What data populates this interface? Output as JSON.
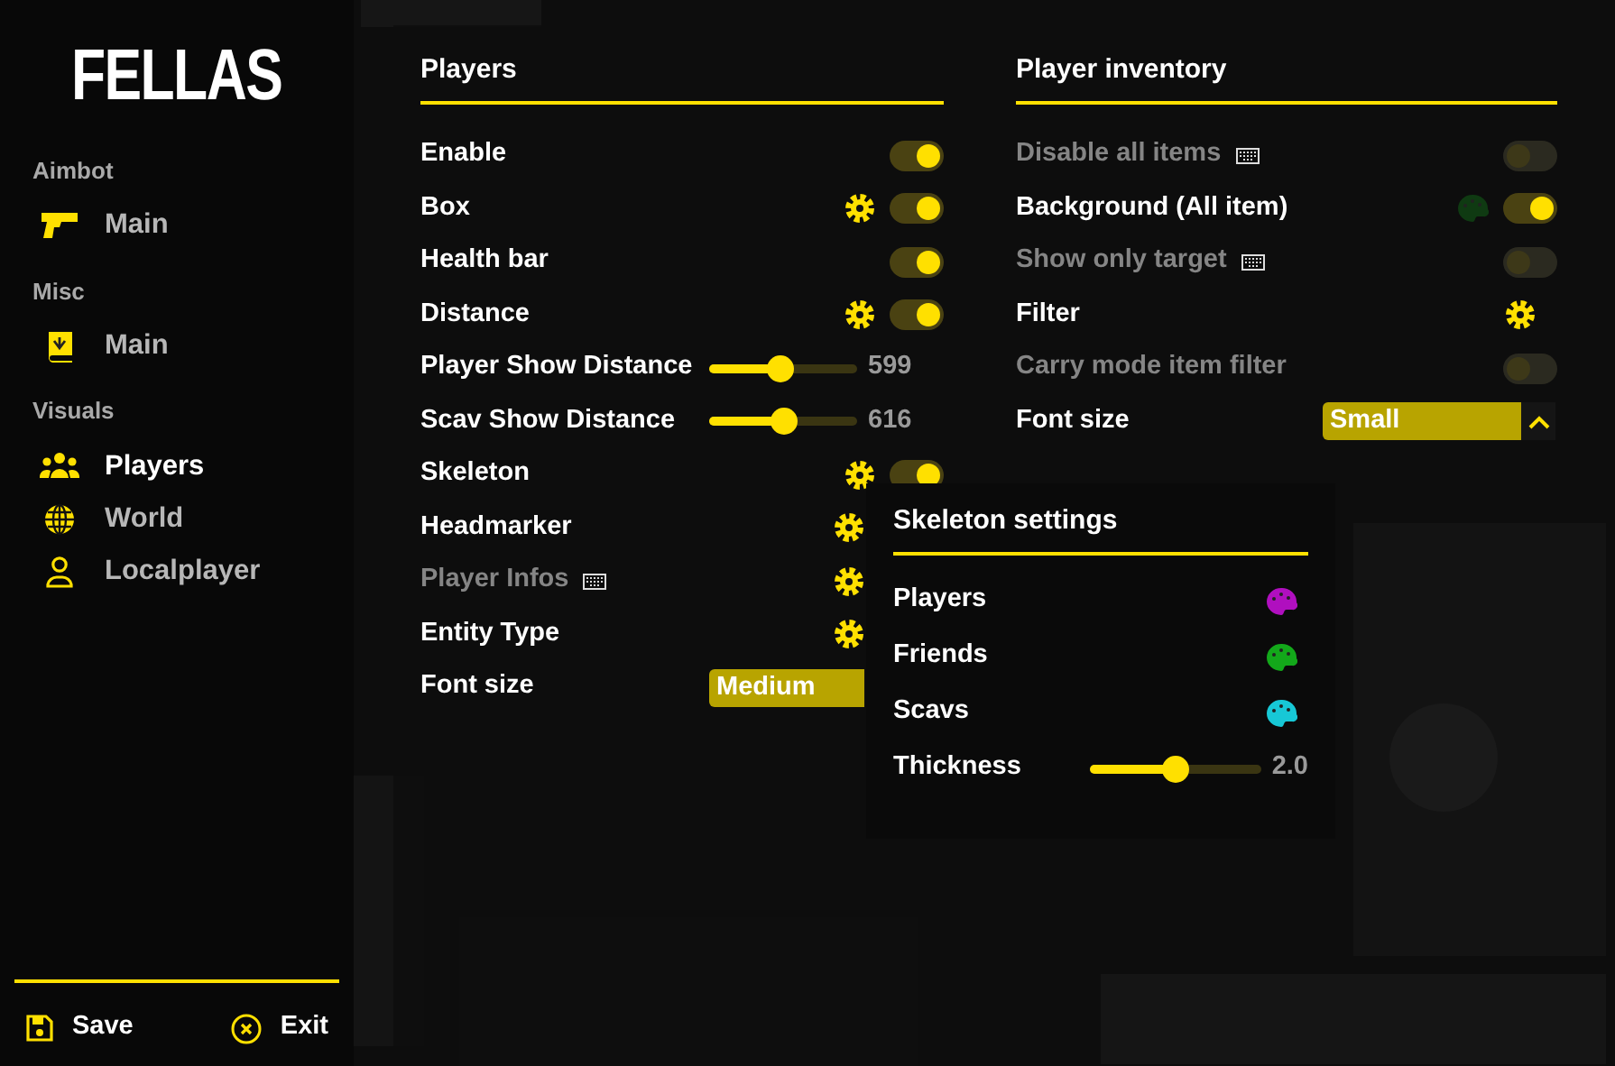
{
  "sidebar": {
    "logo": "FELLAS",
    "groups": [
      {
        "label": "Aimbot",
        "items": [
          {
            "label": "Main",
            "selected": false
          }
        ]
      },
      {
        "label": "Misc",
        "items": [
          {
            "label": "Main",
            "selected": false
          }
        ]
      },
      {
        "label": "Visuals",
        "items": [
          {
            "label": "Players",
            "selected": true
          },
          {
            "label": "World",
            "selected": false
          },
          {
            "label": "Localplayer",
            "selected": false
          }
        ]
      }
    ],
    "footer": [
      {
        "label": "Save"
      },
      {
        "label": "Exit"
      }
    ]
  },
  "players_panel": {
    "title": "Players",
    "rows": [
      {
        "kind": "toggle",
        "label": "Enable",
        "dimmed": false,
        "gear": false,
        "on": true
      },
      {
        "kind": "toggle",
        "label": "Box",
        "dimmed": false,
        "gear": true,
        "on": true
      },
      {
        "kind": "toggle",
        "label": "Health bar",
        "dimmed": false,
        "gear": false,
        "on": true
      },
      {
        "kind": "toggle",
        "label": "Distance",
        "dimmed": false,
        "gear": true,
        "on": true
      },
      {
        "kind": "slider",
        "label": "Player Show Distance",
        "level": 0.48,
        "reading": "599"
      },
      {
        "kind": "slider",
        "label": "Scav Show Distance",
        "level": 0.5,
        "reading": "616"
      },
      {
        "kind": "toggle",
        "label": "Skeleton",
        "dimmed": false,
        "gear": true,
        "on": true
      },
      {
        "kind": "gear",
        "label": "Headmarker",
        "dimmed": false,
        "keybind": false
      },
      {
        "kind": "gear",
        "label": "Player Infos",
        "dimmed": true,
        "keybind": true
      },
      {
        "kind": "gear",
        "label": "Entity Type",
        "dimmed": false,
        "keybind": false
      },
      {
        "kind": "dropdown",
        "label": "Font size",
        "value": "Medium",
        "expanded": false
      }
    ]
  },
  "inventory_panel": {
    "title": "Player inventory",
    "rows": [
      {
        "kind": "toggle",
        "label": "Disable all items",
        "dimmed": true,
        "keybind": true,
        "on": false
      },
      {
        "kind": "toggle",
        "label": "Background (All item)",
        "dimmed": false,
        "color": "#0f3a12",
        "on": true
      },
      {
        "kind": "toggle",
        "label": "Show only target",
        "dimmed": true,
        "keybind": true,
        "on": false
      },
      {
        "kind": "gear",
        "label": "Filter",
        "dimmed": false,
        "keybind": false
      },
      {
        "kind": "toggle",
        "label": "Carry mode item filter",
        "dimmed": true,
        "on": false
      },
      {
        "kind": "dropdown",
        "label": "Font size",
        "value": "Small",
        "expanded": true
      }
    ]
  },
  "skeleton_popup": {
    "title": "Skeleton settings",
    "rows": [
      {
        "kind": "color",
        "label": "Players",
        "color": "#b00fbf"
      },
      {
        "kind": "color",
        "label": "Friends",
        "color": "#13a81a"
      },
      {
        "kind": "color",
        "label": "Scavs",
        "color": "#17c8d6"
      },
      {
        "kind": "slider",
        "label": "Thickness",
        "level": 0.5,
        "reading": "2.0"
      }
    ]
  }
}
